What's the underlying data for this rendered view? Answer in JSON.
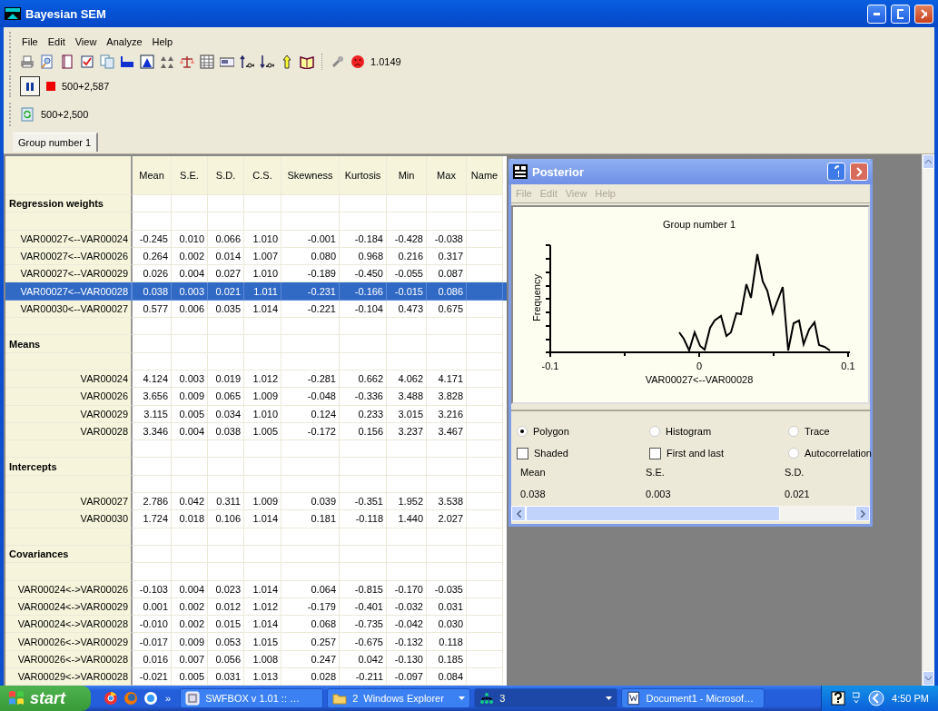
{
  "window": {
    "title": "Bayesian SEM"
  },
  "menu": [
    "File",
    "Edit",
    "View",
    "Analyze",
    "Help"
  ],
  "toolbar": {
    "value": "1.0149"
  },
  "run_toolbar": {
    "paused": true,
    "label": "500+2,587"
  },
  "refresh_toolbar": {
    "label": "500+2,500"
  },
  "tabs": [
    {
      "label": "Group number 1",
      "selected": true
    }
  ],
  "table": {
    "columns": [
      "Mean",
      "S.E.",
      "S.D.",
      "C.S.",
      "Skewness",
      "Kurtosis",
      "Min",
      "Max",
      "Name"
    ],
    "rows": [
      {
        "kind": "section",
        "label": "Regression weights"
      },
      {
        "kind": "blank"
      },
      {
        "kind": "data",
        "label": "VAR00027<--VAR00024",
        "values": [
          "-0.245",
          "0.010",
          "0.066",
          "1.010",
          "-0.001",
          "-0.184",
          "-0.428",
          "-0.038"
        ],
        "selected": false
      },
      {
        "kind": "data",
        "label": "VAR00027<--VAR00026",
        "values": [
          "0.264",
          "0.002",
          "0.014",
          "1.007",
          "0.080",
          "0.968",
          "0.216",
          "0.317"
        ],
        "selected": false
      },
      {
        "kind": "data",
        "label": "VAR00027<--VAR00029",
        "values": [
          "0.026",
          "0.004",
          "0.027",
          "1.010",
          "-0.189",
          "-0.450",
          "-0.055",
          "0.087"
        ],
        "selected": false
      },
      {
        "kind": "data",
        "label": "VAR00027<--VAR00028",
        "values": [
          "0.038",
          "0.003",
          "0.021",
          "1.011",
          "-0.231",
          "-0.166",
          "-0.015",
          "0.086"
        ],
        "selected": true
      },
      {
        "kind": "data",
        "label": "VAR00030<--VAR00027",
        "values": [
          "0.577",
          "0.006",
          "0.035",
          "1.014",
          "-0.221",
          "-0.104",
          "0.473",
          "0.675"
        ],
        "selected": false
      },
      {
        "kind": "blank"
      },
      {
        "kind": "section",
        "label": "Means"
      },
      {
        "kind": "blank"
      },
      {
        "kind": "data",
        "label": "VAR00024",
        "values": [
          "4.124",
          "0.003",
          "0.019",
          "1.012",
          "-0.281",
          "0.662",
          "4.062",
          "4.171"
        ],
        "selected": false
      },
      {
        "kind": "data",
        "label": "VAR00026",
        "values": [
          "3.656",
          "0.009",
          "0.065",
          "1.009",
          "-0.048",
          "-0.336",
          "3.488",
          "3.828"
        ],
        "selected": false
      },
      {
        "kind": "data",
        "label": "VAR00029",
        "values": [
          "3.115",
          "0.005",
          "0.034",
          "1.010",
          "0.124",
          "0.233",
          "3.015",
          "3.216"
        ],
        "selected": false
      },
      {
        "kind": "data",
        "label": "VAR00028",
        "values": [
          "3.346",
          "0.004",
          "0.038",
          "1.005",
          "-0.172",
          "0.156",
          "3.237",
          "3.467"
        ],
        "selected": false
      },
      {
        "kind": "blank"
      },
      {
        "kind": "section",
        "label": "Intercepts"
      },
      {
        "kind": "blank"
      },
      {
        "kind": "data",
        "label": "VAR00027",
        "values": [
          "2.786",
          "0.042",
          "0.311",
          "1.009",
          "0.039",
          "-0.351",
          "1.952",
          "3.538"
        ],
        "selected": false
      },
      {
        "kind": "data",
        "label": "VAR00030",
        "values": [
          "1.724",
          "0.018",
          "0.106",
          "1.014",
          "0.181",
          "-0.118",
          "1.440",
          "2.027"
        ],
        "selected": false
      },
      {
        "kind": "blank"
      },
      {
        "kind": "section",
        "label": "Covariances"
      },
      {
        "kind": "blank"
      },
      {
        "kind": "data",
        "label": "VAR00024<->VAR00026",
        "values": [
          "-0.103",
          "0.004",
          "0.023",
          "1.014",
          "0.064",
          "-0.815",
          "-0.170",
          "-0.035"
        ],
        "selected": false
      },
      {
        "kind": "data",
        "label": "VAR00024<->VAR00029",
        "values": [
          "0.001",
          "0.002",
          "0.012",
          "1.012",
          "-0.179",
          "-0.401",
          "-0.032",
          "0.031"
        ],
        "selected": false
      },
      {
        "kind": "data",
        "label": "VAR00024<->VAR00028",
        "values": [
          "-0.010",
          "0.002",
          "0.015",
          "1.014",
          "0.068",
          "-0.735",
          "-0.042",
          "0.030"
        ],
        "selected": false
      },
      {
        "kind": "data",
        "label": "VAR00026<->VAR00029",
        "values": [
          "-0.017",
          "0.009",
          "0.053",
          "1.015",
          "0.257",
          "-0.675",
          "-0.132",
          "0.118"
        ],
        "selected": false
      },
      {
        "kind": "data",
        "label": "VAR00026<->VAR00028",
        "values": [
          "0.016",
          "0.007",
          "0.056",
          "1.008",
          "0.247",
          "0.042",
          "-0.130",
          "0.185"
        ],
        "selected": false
      },
      {
        "kind": "data",
        "label": "VAR00029<->VAR00028",
        "values": [
          "-0.021",
          "0.005",
          "0.031",
          "1.013",
          "0.028",
          "-0.211",
          "-0.097",
          "0.084"
        ],
        "selected": false
      }
    ]
  },
  "posterior": {
    "title": "Posterior",
    "menu": [
      {
        "label": "File",
        "disabled": true
      },
      {
        "label": "Edit",
        "disabled": true
      },
      {
        "label": "View",
        "disabled": true
      },
      {
        "label": "Help",
        "disabled": true
      }
    ],
    "plot": {
      "title": "Group number 1",
      "ylabel": "Frequency",
      "xticks": [
        "-0.1",
        "0",
        "0.1"
      ],
      "xlabel": "VAR00027<--VAR00028"
    },
    "options": [
      {
        "kind": "radio",
        "label": "Polygon",
        "selected": true
      },
      {
        "kind": "radio",
        "label": "Histogram",
        "selected": false
      },
      {
        "kind": "radio",
        "label": "Trace",
        "selected": false
      },
      {
        "kind": "checkbox",
        "label": "Shaded",
        "checked": false
      },
      {
        "kind": "checkbox",
        "label": "First and last",
        "checked": false
      },
      {
        "kind": "radio",
        "label": "Autocorrelation",
        "selected": false
      }
    ],
    "stats": [
      {
        "label": "Mean",
        "value": "0.038"
      },
      {
        "label": "S.E.",
        "value": "0.003"
      },
      {
        "label": "S.D.",
        "value": "0.021"
      }
    ]
  },
  "taskbar": {
    "start": "start",
    "more": "»",
    "tasks": [
      {
        "label": "SWFBOX v 1.01 :: …",
        "has_menu": false,
        "selected": false
      },
      {
        "count": "2",
        "label": "Windows Explorer",
        "has_menu": true,
        "selected": false
      },
      {
        "count": "3",
        "has_menu": true,
        "selected": true
      },
      {
        "label": "Document1 - Microsof…",
        "has_menu": false,
        "selected": false
      }
    ],
    "clock": "4:50 PM"
  }
}
